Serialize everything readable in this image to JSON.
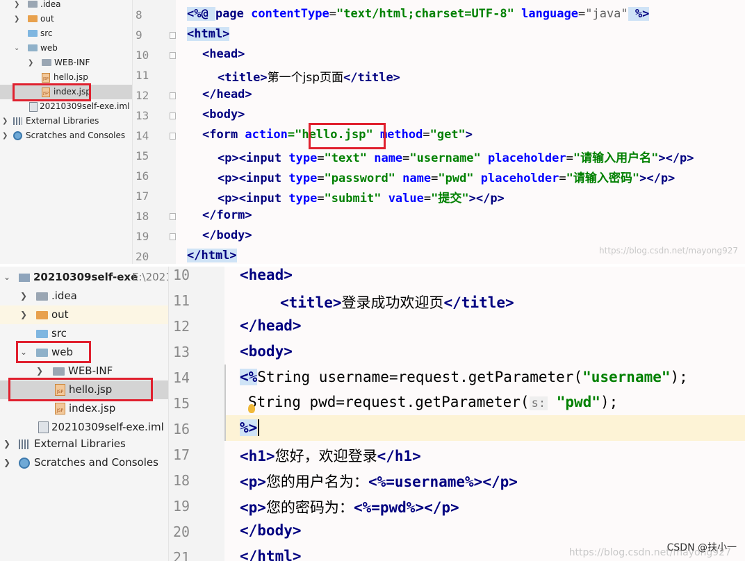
{
  "top": {
    "tree": [
      {
        "label": ".idea",
        "icon": "folder-icon",
        "expanded": false
      },
      {
        "label": "out",
        "icon": "folder-orange-icon",
        "expanded": false
      },
      {
        "label": "src",
        "icon": "folder-blue-icon"
      },
      {
        "label": "web",
        "icon": "web-folder-icon",
        "expanded": true
      },
      {
        "label": "WEB-INF",
        "icon": "folder-icon",
        "expanded": false
      },
      {
        "label": "hello.jsp",
        "icon": "jsp-file-icon"
      },
      {
        "label": "index.jsp",
        "icon": "jsp-file-icon",
        "selected": true
      },
      {
        "label": "20210309self-exe.iml",
        "icon": "iml-file-icon"
      },
      {
        "label": "External Libraries",
        "icon": "library-icon",
        "expanded": false
      },
      {
        "label": "Scratches and Consoles",
        "icon": "scratches-icon",
        "expanded": false
      }
    ],
    "line_numbers": [
      "8",
      "9",
      "10",
      "11",
      "12",
      "13",
      "14",
      "15",
      "16",
      "17",
      "18",
      "19",
      "20"
    ],
    "code": {
      "l8_a": "<%@ ",
      "l8_b": "page ",
      "l8_c": "contentType",
      "l8_d": "=",
      "l8_e": "\"text/html;charset=UTF-8\"",
      "l8_f": " language",
      "l8_g": "=",
      "l8_h": "\"java\"",
      "l8_i": " %>",
      "l9": "<html>",
      "l10": "<head>",
      "l11_a": "<title>",
      "l11_b": "第一个jsp页面",
      "l11_c": "</title>",
      "l12": "</head>",
      "l13": "<body>",
      "l14_a": "<form ",
      "l14_b": "action",
      "l14_c": "=\"",
      "l14_d": "hello.jsp",
      "l14_e": "\"",
      "l14_f": " method",
      "l14_g": "=",
      "l14_h": "\"get\"",
      "l14_i": ">",
      "l15_a": "<p><input ",
      "l15_b": "type",
      "l15_c": "=",
      "l15_d": "\"text\"",
      "l15_e": " name",
      "l15_f": "=",
      "l15_g": "\"username\"",
      "l15_h": " placeholder",
      "l15_i": "=",
      "l15_j": "\"请输入用户名\"",
      "l15_k": "></p>",
      "l16_a": "<p><input ",
      "l16_b": "type",
      "l16_c": "=",
      "l16_d": "\"password\"",
      "l16_e": " name",
      "l16_f": "=",
      "l16_g": "\"pwd\"",
      "l16_h": " placeholder",
      "l16_i": "=",
      "l16_j": "\"请输入密码\"",
      "l16_k": "></p>",
      "l17_a": "<p><input ",
      "l17_b": "type",
      "l17_c": "=",
      "l17_d": "\"submit\"",
      "l17_e": " value",
      "l17_f": "=",
      "l17_g": "\"提交\"",
      "l17_h": "></p>",
      "l18": "</form>",
      "l19": "</body>",
      "l20": "</html>"
    },
    "watermark": "https://blog.csdn.net/mayong927"
  },
  "bottom": {
    "project": {
      "name": "20210309self-exe",
      "path": "E:\\2021"
    },
    "tree": [
      {
        "label": ".idea",
        "icon": "folder-icon",
        "expanded": false
      },
      {
        "label": "out",
        "icon": "folder-orange-icon",
        "expanded": false
      },
      {
        "label": "src",
        "icon": "folder-blue-icon"
      },
      {
        "label": "web",
        "icon": "web-folder-icon",
        "expanded": true
      },
      {
        "label": "WEB-INF",
        "icon": "folder-icon",
        "expanded": false
      },
      {
        "label": "hello.jsp",
        "icon": "jsp-file-icon",
        "selected": true
      },
      {
        "label": "index.jsp",
        "icon": "jsp-file-icon"
      },
      {
        "label": "20210309self-exe.iml",
        "icon": "iml-file-icon"
      },
      {
        "label": "External Libraries",
        "icon": "library-icon",
        "expanded": false
      },
      {
        "label": "Scratches and Consoles",
        "icon": "scratches-icon",
        "expanded": false
      }
    ],
    "line_numbers": [
      "10",
      "11",
      "12",
      "13",
      "14",
      "15",
      "16",
      "17",
      "18",
      "19",
      "20",
      "21"
    ],
    "code": {
      "l10": "<head>",
      "l11_a": "<title>",
      "l11_b": "登录成功欢迎页",
      "l11_c": "</title>",
      "l12": "</head>",
      "l13": "<body>",
      "l14_a": "<%",
      "l14_b": "String username=request.getParameter(",
      "l14_c": "\"username\"",
      "l14_d": ");",
      "l15_a": "String pwd=request.getParameter(",
      "l15_hint": "s:",
      "l15_c": "\"pwd\"",
      "l15_d": ");",
      "l16": "%>",
      "l17_a": "<h1>",
      "l17_b": "您好，欢迎登录",
      "l17_c": "</h1>",
      "l18_a": "<p>",
      "l18_b": "您的用户名为：",
      "l18_c": "<%=username%>",
      "l18_d": "</p>",
      "l19_a": "<p>",
      "l19_b": "您的密码为：",
      "l19_c": "<%=pwd%>",
      "l19_d": "</p>",
      "l20": "</body>",
      "l21": "</html>"
    },
    "watermark": "https://blog.csdn.net/mayong927",
    "credit": "CSDN @扶小一"
  },
  "colors": {
    "tag": "#000080",
    "attr": "#0000ff",
    "string": "#008000",
    "highlight_box": "#e0202e"
  }
}
